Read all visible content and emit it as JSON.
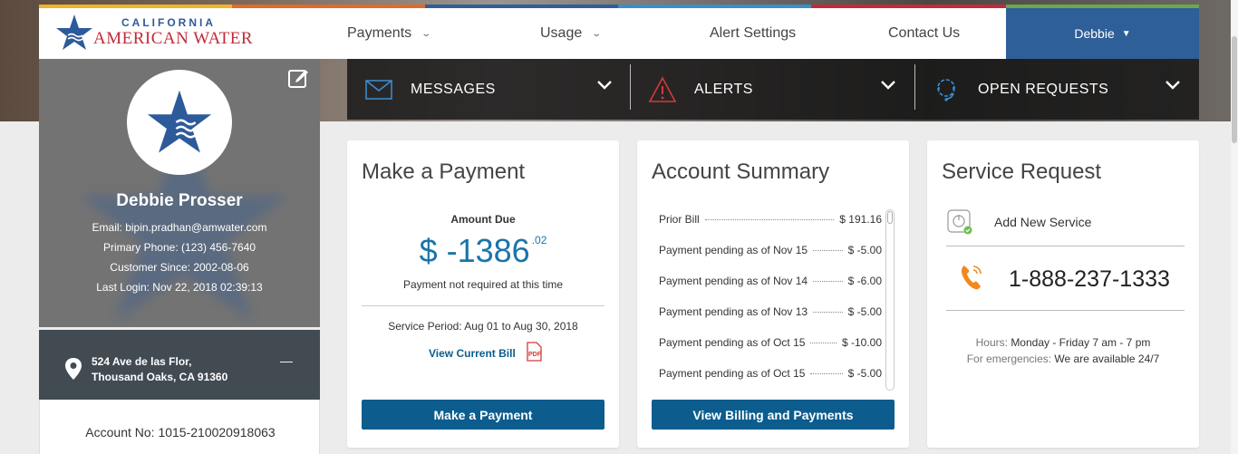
{
  "brand": {
    "line1": "CALIFORNIA",
    "line2": "AMERICAN WATER",
    "colors": {
      "blue": "#2f5f99",
      "red": "#c32a3a",
      "button": "#0c5d8e"
    }
  },
  "nav": {
    "items": [
      {
        "label": "Payments",
        "has_dropdown": true
      },
      {
        "label": "Usage",
        "has_dropdown": true
      },
      {
        "label": "Alert Settings",
        "has_dropdown": false
      },
      {
        "label": "Contact Us",
        "has_dropdown": false
      }
    ],
    "user": "Debbie"
  },
  "notifications": [
    {
      "label": "MESSAGES",
      "icon": "envelope-icon"
    },
    {
      "label": "ALERTS",
      "icon": "warning-icon"
    },
    {
      "label": "OPEN REQUESTS",
      "icon": "support-icon"
    }
  ],
  "profile": {
    "name": "Debbie Prosser",
    "email": "Email: bipin.pradhan@amwater.com",
    "phone": "Primary Phone: (123) 456-7640",
    "since": "Customer Since: 2002-08-06",
    "last_login": "Last Login: Nov 22, 2018 02:39:13",
    "address_line1": "524 Ave de las Flor,",
    "address_line2": "Thousand Oaks, CA 91360",
    "collapse_symbol": "—",
    "account_no": "Account No: 1015-210020918063"
  },
  "payment": {
    "title": "Make a Payment",
    "amount_label": "Amount Due",
    "amount_main": "$ -1386",
    "amount_cents": ".02",
    "note": "Payment not required at this time",
    "period": "Service Period: Aug 01 to Aug 30, 2018",
    "view_bill": "View Current Bill",
    "button": "Make a Payment"
  },
  "summary": {
    "title": "Account Summary",
    "rows": [
      {
        "label": "Prior Bill",
        "value": "$ 191.16"
      },
      {
        "label": "Payment pending as of Nov 15",
        "value": "$ -5.00"
      },
      {
        "label": "Payment pending as of Nov 14",
        "value": "$ -6.00"
      },
      {
        "label": "Payment pending as of Nov 13",
        "value": "$ -5.00"
      },
      {
        "label": "Payment pending as of Oct 15",
        "value": "$ -10.00"
      },
      {
        "label": "Payment pending as of Oct 15",
        "value": "$ -5.00"
      }
    ],
    "button": "View Billing and Payments"
  },
  "service": {
    "title": "Service Request",
    "add_new": "Add New Service",
    "phone": "1-888-237-1333",
    "hours_label": "Hours:",
    "hours_value": "Monday - Friday 7 am - 7 pm",
    "emergency_label": "For emergencies:",
    "emergency_value": "We are available 24/7"
  }
}
